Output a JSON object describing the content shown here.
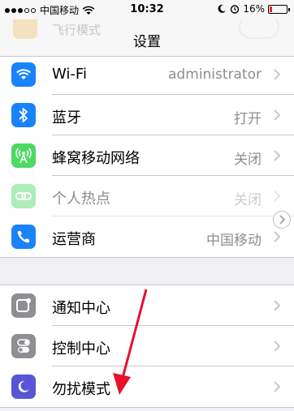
{
  "status_bar": {
    "carrier": "中国移动",
    "time": "10:32",
    "battery": "16%",
    "battery_level": 0.16,
    "icons": [
      "signal-dots",
      "wifi-icon",
      "moon-icon",
      "alarm-icon",
      "battery-icon"
    ]
  },
  "nav": {
    "title": "设置",
    "ghost_row_label": "飞行模式"
  },
  "group1": [
    {
      "label": "Wi-Fi",
      "value": "administrator",
      "icon": "wifi-icon",
      "color": "#1a82fb"
    },
    {
      "label": "蓝牙",
      "value": "打开",
      "icon": "bluetooth-icon",
      "color": "#1a82fb"
    },
    {
      "label": "蜂窝移动网络",
      "value": "关闭",
      "icon": "antenna-icon",
      "color": "#4cd964"
    },
    {
      "label": "个人热点",
      "value": "关闭",
      "icon": "link-icon",
      "color": "#4cd964"
    },
    {
      "label": "运营商",
      "value": "中国移动",
      "icon": "phone-icon",
      "color": "#1a82fb"
    }
  ],
  "group2": [
    {
      "label": "通知中心",
      "icon": "notification-icon",
      "color": "#8e8e93"
    },
    {
      "label": "控制中心",
      "icon": "toggles-icon",
      "color": "#8e8e93"
    },
    {
      "label": "勿扰模式",
      "icon": "moon-icon",
      "color": "#5856d6"
    }
  ],
  "annotation": {
    "color": "#e8102a"
  }
}
